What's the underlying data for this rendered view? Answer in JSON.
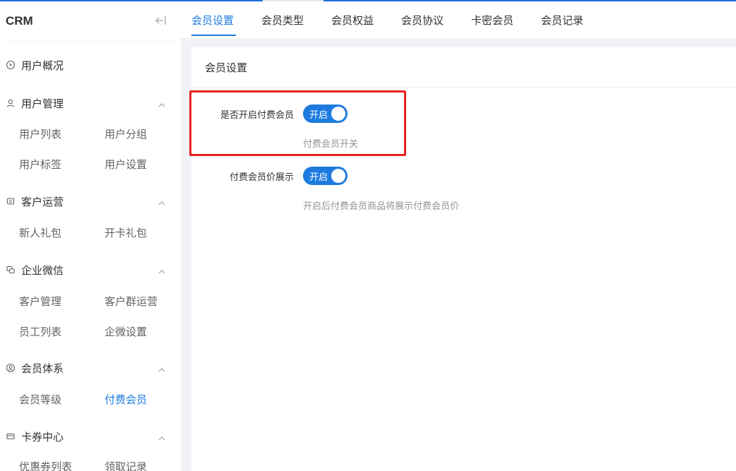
{
  "sidebar": {
    "brand": "CRM",
    "groups": [
      {
        "title": "用户概况",
        "icon": "overview-icon",
        "items": []
      },
      {
        "title": "用户管理",
        "icon": "user-icon",
        "items": [
          "用户列表",
          "用户分组",
          "用户标签",
          "用户设置"
        ]
      },
      {
        "title": "客户运营",
        "icon": "customer-icon",
        "items": [
          "新人礼包",
          "开卡礼包"
        ]
      },
      {
        "title": "企业微信",
        "icon": "wechat-work-icon",
        "items": [
          "客户管理",
          "客户群运营",
          "员工列表",
          "企微设置"
        ]
      },
      {
        "title": "会员体系",
        "icon": "member-icon",
        "items": [
          "会员等级",
          "付费会员"
        ]
      },
      {
        "title": "卡券中心",
        "icon": "coupon-icon",
        "items": [
          "优惠券列表",
          "领取记录"
        ]
      }
    ],
    "active_item": "付费会员"
  },
  "tabs": [
    "会员设置",
    "会员类型",
    "会员权益",
    "会员协议",
    "卡密会员",
    "会员记录"
  ],
  "active_tab": "会员设置",
  "card": {
    "title": "会员设置",
    "fields": [
      {
        "label": "是否开启付费会员",
        "switch_text": "开启",
        "enabled": true,
        "help": "付费会员开关"
      },
      {
        "label": "付费会员价展示",
        "switch_text": "开启",
        "enabled": true,
        "help": "开启后付费会员商品将展示付费会员价"
      }
    ]
  },
  "colors": {
    "accent": "#1d7be0",
    "highlight": "#e8221b"
  }
}
